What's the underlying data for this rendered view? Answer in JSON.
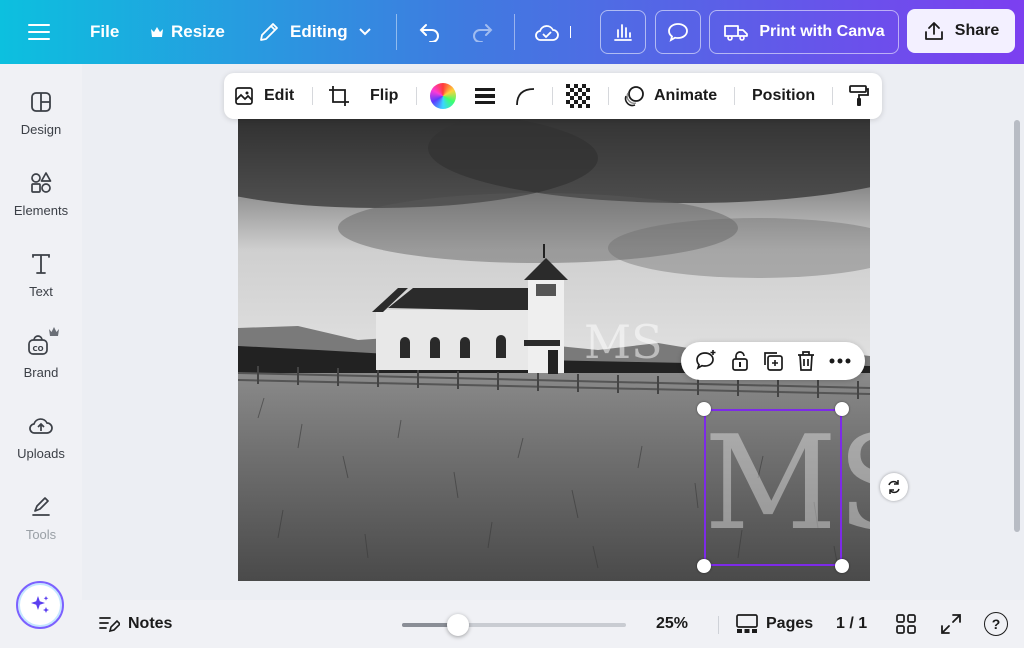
{
  "header": {
    "file_label": "File",
    "resize_label": "Resize",
    "editing_label": "Editing",
    "print_label": "Print with Canva",
    "share_label": "Share"
  },
  "sidebar": {
    "items": [
      {
        "label": "Design",
        "icon": "layout-icon"
      },
      {
        "label": "Elements",
        "icon": "shapes-icon"
      },
      {
        "label": "Text",
        "icon": "text-icon"
      },
      {
        "label": "Brand",
        "icon": "brand-icon"
      },
      {
        "label": "Uploads",
        "icon": "cloud-upload-icon"
      },
      {
        "label": "Tools",
        "icon": "pen-tool-icon"
      }
    ]
  },
  "context_toolbar": {
    "edit_label": "Edit",
    "flip_label": "Flip",
    "animate_label": "Animate",
    "position_label": "Position"
  },
  "watermark": {
    "mark": "MS"
  },
  "footer": {
    "notes_label": "Notes",
    "zoom_value": "25%",
    "zoom_fraction": 0.25,
    "pages_label": "Pages",
    "page_indicator": "1 / 1",
    "help_label": "?"
  },
  "colors": {
    "header_gradient_start": "#0cc0df",
    "header_gradient_end": "#7c3ff0",
    "selection": "#7d2ae8"
  }
}
